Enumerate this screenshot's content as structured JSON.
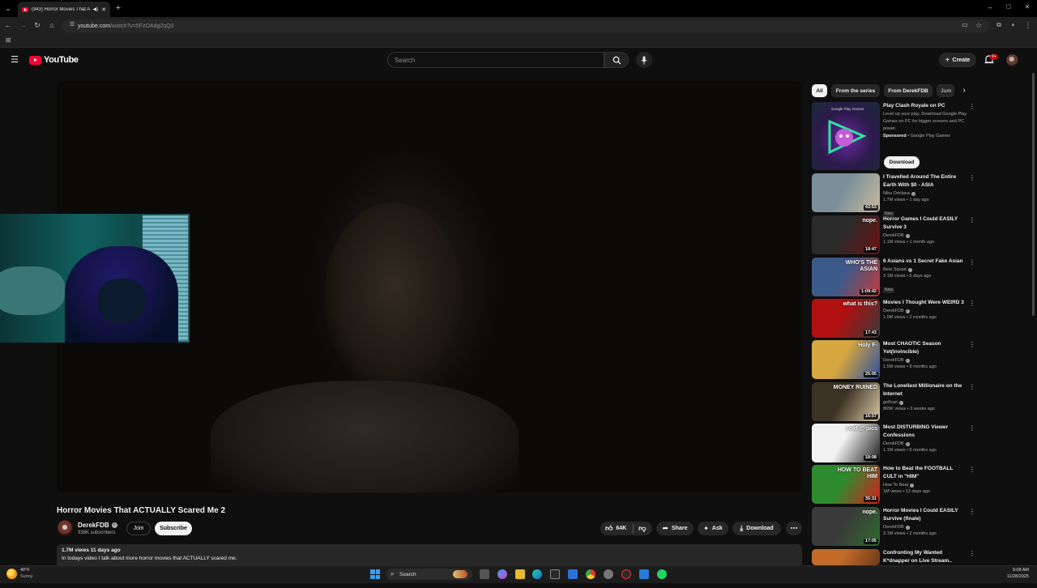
{
  "browser": {
    "tab_title": "(943) Horror Movies That A",
    "url_host": "youtube.com",
    "url_path": "/watch?v=5FzOAdg2qQ0"
  },
  "header": {
    "logo_text": "YouTube",
    "search_placeholder": "Search",
    "create_label": "Create",
    "notifications_badge": "9+"
  },
  "video": {
    "title": "Horror Movies That ACTUALLY Scared Me 2",
    "channel": "DerekFDB",
    "subscribers": "938K subscribers",
    "join_label": "Join",
    "subscribe_label": "Subscribe",
    "likes": "64K",
    "share_label": "Share",
    "ask_label": "Ask",
    "download_label": "Download",
    "views_date": "1.7M views  11 days ago",
    "description": "In todays video I talk about more horror movies that ACTUALLY scared me."
  },
  "sidebar": {
    "chips": [
      "All",
      "From the series",
      "From DerekFDB",
      "Jum"
    ],
    "ad": {
      "title": "Play Clash Royale on PC",
      "text": "Level up your play. Download Google Play Games on PC for bigger screens and PC power.",
      "sponsored": "Sponsored",
      "advertiser": "Google Play Games",
      "thumb_label": "Google Play Games",
      "cta": "Download"
    },
    "items": [
      {
        "title": "I Travelled Around The Entire Earth With $0 - ASIA",
        "channel": "Niko Omilana",
        "views": "1.7M views • 1 day ago",
        "badge": "New",
        "duration": "43:53",
        "thumb_text": "",
        "colors": [
          "#7a8f9a",
          "#c9b9a0"
        ]
      },
      {
        "title": "Horror Games I Could EASILY Survive 3",
        "channel": "DerekFDB",
        "views": "1.1M views • 1 month ago",
        "badge": "",
        "duration": "18:47",
        "thumb_text": "nope.",
        "colors": [
          "#2a2a2a",
          "#6b1212"
        ]
      },
      {
        "title": "6 Asians vs 1 Secret Fake Asian",
        "channel": "Beta Squad",
        "views": "3.1M views • 5 days ago",
        "badge": "New",
        "duration": "1:09:42",
        "thumb_text": "WHO'S THE ASIAN",
        "colors": [
          "#3b5a8a",
          "#c43a3a"
        ]
      },
      {
        "title": "Movies I Thought Were WEIRD 3",
        "channel": "DerekFDB",
        "views": "1.5M views • 2 months ago",
        "badge": "",
        "duration": "17:43",
        "thumb_text": "what is this?",
        "colors": [
          "#b01010",
          "#3a3a3a"
        ]
      },
      {
        "title": "Most CHAOTIC Season Yet(Invincible)",
        "channel": "DerekFDB",
        "views": "1.5M views • 8 months ago",
        "badge": "",
        "duration": "25:05",
        "thumb_text": "Holy F-",
        "colors": [
          "#d6a640",
          "#2b4fa0"
        ]
      },
      {
        "title": "The Loneliest Millionaire on the Internet",
        "channel": "golfcart",
        "views": "865K views • 3 weeks ago",
        "badge": "",
        "duration": "16:57",
        "thumb_text": "MONEY RUINED",
        "colors": [
          "#3d3324",
          "#d9c9a8"
        ]
      },
      {
        "title": "Most DISTURBING Viewer Confessions",
        "channel": "DerekFDB",
        "views": "1.1M views • 5 months ago",
        "badge": "",
        "duration": "18:08",
        "thumb_text": "sold @ pics",
        "colors": [
          "#f2f2f2",
          "#1b1b1b"
        ]
      },
      {
        "title": "How to Beat the FOOTBALL CULT in \"HIM\"",
        "channel": "How To Beat",
        "views": "1M views • 12 days ago",
        "badge": "",
        "duration": "35:31",
        "thumb_text": "HOW TO BEAT HIM",
        "colors": [
          "#2e8a2e",
          "#d42020"
        ]
      },
      {
        "title": "Horror Movies I Could EASILY Survive (finale)",
        "channel": "DerekFDB",
        "views": "3.1M views • 2 months ago",
        "badge": "",
        "duration": "17:05",
        "thumb_text": "nope.",
        "colors": [
          "#3a3a3a",
          "#2f6a2f"
        ]
      },
      {
        "title": "Confronting My Wanted K*dnapper on Live Stream..",
        "channel": "",
        "views": "",
        "badge": "",
        "duration": "",
        "thumb_text": "",
        "colors": [
          "#c26a2a",
          "#6b3a1a"
        ]
      }
    ]
  },
  "taskbar": {
    "temperature": "40°F",
    "condition": "Sunny",
    "search_label": "Search",
    "time": "9:08 AM",
    "date": "11/28/2025"
  },
  "colors": {
    "background": "#0f0f0f",
    "accent_red": "#ff0033",
    "pill": "#272727"
  }
}
